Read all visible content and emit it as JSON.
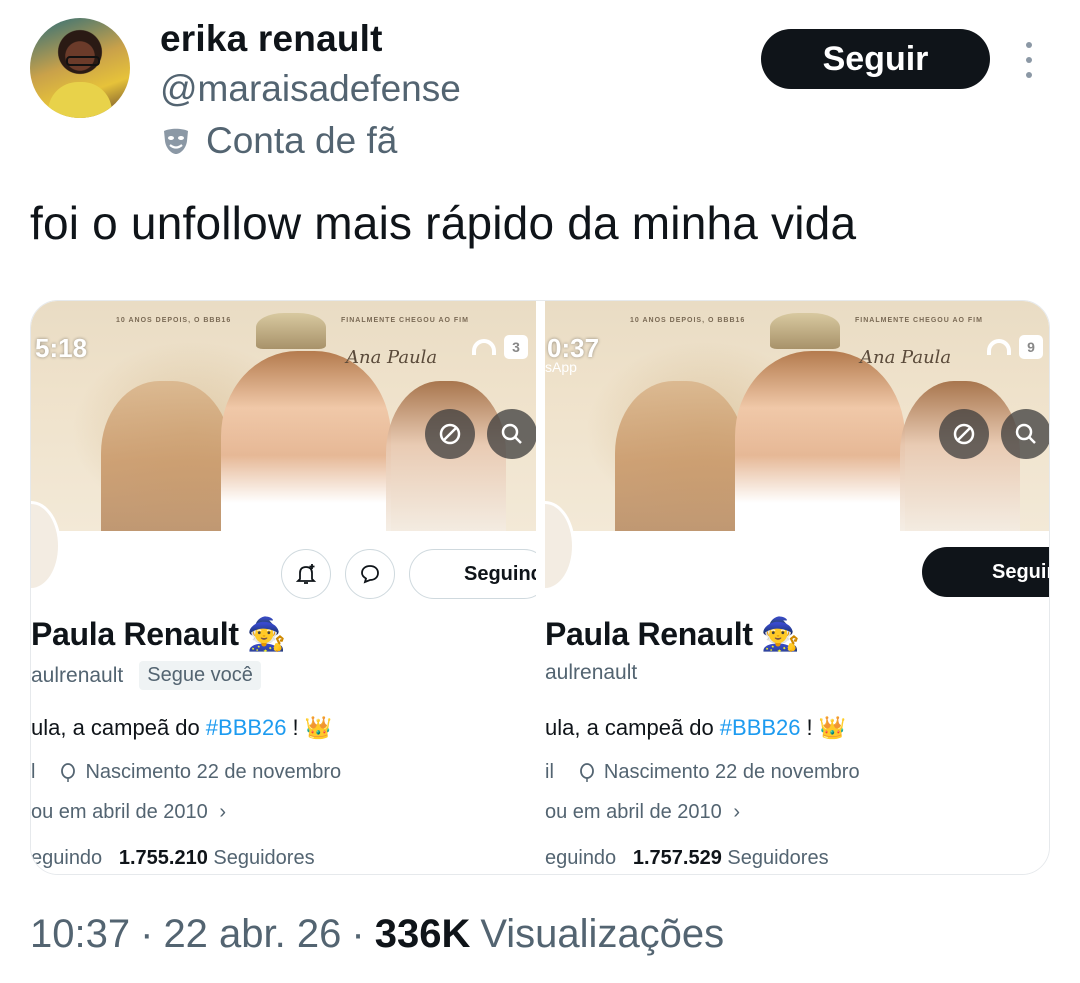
{
  "author": {
    "display_name": "erika renault",
    "handle": "@maraisadefense",
    "fan_label": "Conta de fã"
  },
  "actions": {
    "follow_label": "Seguir"
  },
  "tweet": {
    "text": "foi o unfollow mais rápido da minha vida"
  },
  "screenshots": [
    {
      "status_time": "5:18",
      "battery": "3",
      "banner_tagline_left": "10 ANOS DEPOIS, O BBB16",
      "banner_tagline_right": "FINALMENTE CHEGOU AO FIM",
      "banner_script": "Ana Paula",
      "following_label": "Seguind",
      "name": "Paula Renault",
      "handle": "aulrenault",
      "follows_you": "Segue você",
      "bio_prefix": "ula, a campeã do ",
      "bio_tag": "#BBB26",
      "bio_suffix": "!",
      "location_fragment": "l",
      "birth": "Nascimento 22 de novembro",
      "joined": "ou em abril de 2010",
      "following_fragment": "eguindo",
      "followers_count": "1.755.210",
      "followers_label": "Seguidores"
    },
    {
      "status_time": "0:37",
      "battery": "9",
      "app_back": "sApp",
      "banner_tagline_left": "10 ANOS DEPOIS, O BBB16",
      "banner_tagline_right": "FINALMENTE CHEGOU AO FIM",
      "banner_script": "Ana Paula",
      "follow_label": "Seguir",
      "name": "Paula Renault",
      "handle": "aulrenault",
      "bio_prefix": "ula, a campeã do ",
      "bio_tag": "#BBB26",
      "bio_suffix": "!",
      "location_fragment": "il",
      "birth": "Nascimento 22 de novembro",
      "joined": "ou em abril de 2010",
      "following_fragment": "eguindo",
      "followers_count": "1.757.529",
      "followers_label": "Seguidores"
    }
  ],
  "meta": {
    "time": "10:37",
    "date": "22 abr. 26",
    "views_count": "336K",
    "views_label": "Visualizações"
  },
  "icons": {
    "mask": "theater-mask-icon",
    "more": "more-vertical-icon",
    "emoji_witch": "🧙",
    "emoji_crown": "👑",
    "chevron": "›"
  },
  "colors": {
    "text": "#0f1419",
    "muted": "#536471",
    "link": "#1d9bf0",
    "button_dark": "#0f1419"
  }
}
